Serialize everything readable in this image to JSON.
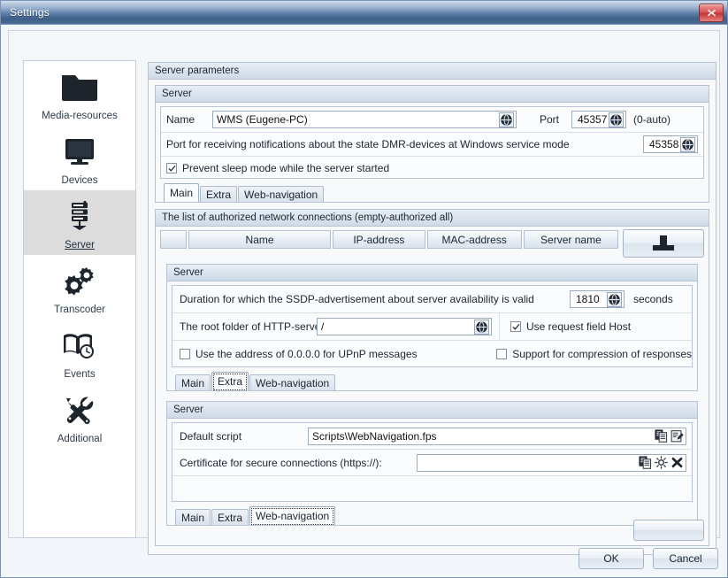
{
  "window": {
    "title": "Settings",
    "close_label": "Close"
  },
  "sidebar": {
    "items": [
      {
        "label": "Media-resources",
        "icon": "folder-icon",
        "selected": false
      },
      {
        "label": "Devices",
        "icon": "monitor-icon",
        "selected": false
      },
      {
        "label": "Server",
        "icon": "server-rack-icon",
        "selected": true
      },
      {
        "label": "Transcoder",
        "icon": "gears-icon",
        "selected": false
      },
      {
        "label": "Events",
        "icon": "book-clock-icon",
        "selected": false
      },
      {
        "label": "Additional",
        "icon": "tools-icon",
        "selected": false
      }
    ]
  },
  "main": {
    "group_title": "Server parameters",
    "section_main": {
      "title": "Server",
      "name_label": "Name",
      "name_value": "WMS (Eugene-PC)",
      "name_button_icon": "globe-icon",
      "port_label": "Port",
      "port_value": "45357",
      "port_button_icon": "globe-icon",
      "port_hint": "(0-auto)",
      "dmr_label": "Port for receiving notifications about the state DMR-devices at Windows service mode",
      "dmr_value": "45358",
      "dmr_button_icon": "globe-icon",
      "prevent_sleep_label": "Prevent sleep mode while the server started",
      "prevent_sleep_checked": true,
      "tabs": [
        {
          "label": "Main",
          "active": true,
          "focused": false
        },
        {
          "label": "Extra",
          "active": false,
          "focused": false
        },
        {
          "label": "Web-navigation",
          "active": false,
          "focused": false
        }
      ]
    },
    "section_connections": {
      "title": "The list of authorized network connections (empty-authorized all)",
      "columns": [
        "",
        "Name",
        "IP-address",
        "MAC-address",
        "Server name"
      ],
      "rows": [],
      "add_button_icon": "add-plug-icon"
    },
    "section_extra": {
      "title": "Server",
      "ssdp_label": "Duration for which the SSDP-advertisement about server availability is valid",
      "ssdp_value": "1810",
      "ssdp_button_icon": "globe-icon",
      "ssdp_units": "seconds",
      "root_label": "The root folder of HTTP-server",
      "root_value": "/",
      "root_button_icon": "globe-icon",
      "use_host_label": "Use request field Host",
      "use_host_checked": true,
      "upnp_label": "Use the address of 0.0.0.0 for UPnP messages",
      "upnp_checked": false,
      "compression_label": "Support for compression of responses",
      "compression_checked": false,
      "tabs": [
        {
          "label": "Main",
          "active": false,
          "focused": false
        },
        {
          "label": "Extra",
          "active": true,
          "focused": true
        },
        {
          "label": "Web-navigation",
          "active": false,
          "focused": false
        }
      ]
    },
    "section_webnav": {
      "title": "Server",
      "script_label": "Default script",
      "script_value": "Scripts\\WebNavigation.fps",
      "script_buttons": [
        "copy-icon",
        "edit-icon"
      ],
      "cert_label": "Certificate for secure connections (https://):",
      "cert_value": "",
      "cert_buttons": [
        "copy-icon",
        "settings-sun-icon",
        "delete-x-icon"
      ],
      "tabs": [
        {
          "label": "Main",
          "active": false,
          "focused": false
        },
        {
          "label": "Extra",
          "active": false,
          "focused": false
        },
        {
          "label": "Web-navigation",
          "active": true,
          "focused": true
        }
      ]
    },
    "bottom_button_label": ""
  },
  "footer": {
    "ok_label": "OK",
    "cancel_label": "Cancel"
  },
  "colors": {
    "title_bar": "#4a6c94",
    "close_button": "#c43535",
    "selected_sidebar": "#dcdcdc",
    "panel_bg": "#f4f7fa"
  }
}
